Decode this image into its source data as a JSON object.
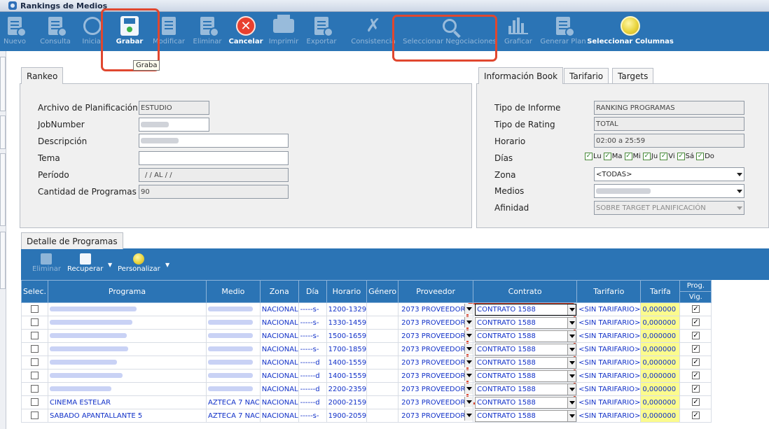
{
  "window": {
    "title": "Rankings de Medios"
  },
  "toolbar": [
    {
      "id": "nuevo",
      "label": "Nuevo",
      "icon": "new-document-icon",
      "enabled": false
    },
    {
      "id": "consulta",
      "label": "Consulta",
      "icon": "query-icon",
      "enabled": false
    },
    {
      "id": "inicial",
      "label": "Inicial",
      "icon": "play-icon",
      "enabled": false
    },
    {
      "id": "grabar",
      "label": "Grabar",
      "icon": "save-icon",
      "enabled": true
    },
    {
      "id": "modificar",
      "label": "Modificar",
      "icon": "edit-icon",
      "enabled": false
    },
    {
      "id": "eliminar",
      "label": "Eliminar",
      "icon": "delete-document-icon",
      "enabled": false
    },
    {
      "id": "cancelar",
      "label": "Cancelar",
      "icon": "cancel-icon",
      "enabled": true
    },
    {
      "id": "imprimir",
      "label": "Imprimir",
      "icon": "printer-icon",
      "enabled": false
    },
    {
      "id": "exportar",
      "label": "Exportar",
      "icon": "export-icon",
      "enabled": false
    },
    {
      "id": "consistencia",
      "label": "Consistencia",
      "icon": "tools-icon",
      "enabled": false
    },
    {
      "id": "seleccionar_negociaciones",
      "label": "Seleccionar Negociaciones",
      "icon": "magnifier-icon",
      "enabled": false
    },
    {
      "id": "graficar",
      "label": "Graficar",
      "icon": "bar-chart-icon",
      "enabled": false
    },
    {
      "id": "generar_plan",
      "label": "Generar Plan",
      "icon": "generate-plan-icon",
      "enabled": false
    },
    {
      "id": "seleccionar_columnas",
      "label": "Seleccionar Columnas",
      "icon": "columns-globe-icon",
      "enabled": true
    }
  ],
  "tooltip": "Graba",
  "rankeo": {
    "tab": "Rankeo",
    "fields": {
      "archivo_label": "Archivo de Planificación",
      "archivo_value": "ESTUDIO",
      "jobnumber_label": "JobNumber",
      "descripcion_label": "Descripción",
      "tema_label": "Tema",
      "tema_value": "",
      "periodo_label": "Período",
      "periodo_value": "/ /    AL  / /",
      "cantidad_label": "Cantidad de Programas",
      "cantidad_value": "90"
    }
  },
  "info_book": {
    "tabs": [
      "Información Book",
      "Tarifario",
      "Targets"
    ],
    "fields": {
      "tipo_informe_label": "Tipo de Informe",
      "tipo_informe_value": "RANKING PROGRAMAS",
      "tipo_rating_label": "Tipo de Rating",
      "tipo_rating_value": "TOTAL",
      "horario_label": "Horario",
      "horario_value": "02:00 a 25:59",
      "dias_label": "Días",
      "zona_label": "Zona",
      "zona_value": "<TODAS>",
      "medios_label": "Medios",
      "afinidad_label": "Afinidad",
      "afinidad_value": "SOBRE TARGET PLANIFICACIÓN"
    },
    "days": [
      {
        "label": "Lu",
        "checked": true
      },
      {
        "label": "Ma",
        "checked": true
      },
      {
        "label": "Mi",
        "checked": true
      },
      {
        "label": "Ju",
        "checked": true
      },
      {
        "label": "Vi",
        "checked": true
      },
      {
        "label": "Sá",
        "checked": true
      },
      {
        "label": "Do",
        "checked": true
      }
    ]
  },
  "detalle": {
    "tab": "Detalle de Programas",
    "toolbar": [
      {
        "label": "Eliminar",
        "enabled": false
      },
      {
        "label": "Recuperar",
        "enabled": true
      },
      {
        "label": "Personalizar",
        "enabled": true
      }
    ],
    "columns": [
      "Selec.",
      "Programa",
      "Medio",
      "Zona",
      "Día",
      "Horario",
      "Género",
      "Proveedor",
      "Contrato",
      "Tarifario",
      "Tarifa",
      "Prog.",
      "Vig."
    ],
    "rows": [
      {
        "programa": "",
        "medio": "",
        "zona": "NACIONAL",
        "dia": "-----s-",
        "horario": "1200-1329",
        "genero": "",
        "proveedor": "2073 PROVEEDOR",
        "contrato": "CONTRATO 1588",
        "tarifario": "<SIN TARIFARIO>",
        "tarifa": "0,000000",
        "vig": true
      },
      {
        "programa": "",
        "medio": "",
        "zona": "NACIONAL",
        "dia": "-----s-",
        "horario": "1330-1459",
        "genero": "",
        "proveedor": "2073 PROVEEDOR",
        "contrato": "CONTRATO 1588",
        "tarifario": "<SIN TARIFARIO>",
        "tarifa": "0,000000",
        "vig": true
      },
      {
        "programa": "",
        "medio": "",
        "zona": "NACIONAL",
        "dia": "-----s-",
        "horario": "1500-1659",
        "genero": "",
        "proveedor": "2073 PROVEEDOR",
        "contrato": "CONTRATO 1588",
        "tarifario": "<SIN TARIFARIO>",
        "tarifa": "0,000000",
        "vig": true
      },
      {
        "programa": "",
        "medio": "",
        "zona": "NACIONAL",
        "dia": "-----s-",
        "horario": "1700-1859",
        "genero": "",
        "proveedor": "2073 PROVEEDOR",
        "contrato": "CONTRATO 1588",
        "tarifario": "<SIN TARIFARIO>",
        "tarifa": "0,000000",
        "vig": true
      },
      {
        "programa": "",
        "medio": "",
        "zona": "NACIONAL",
        "dia": "------d",
        "horario": "1400-1559",
        "genero": "",
        "proveedor": "2073 PROVEEDOR",
        "contrato": "CONTRATO 1588",
        "tarifario": "<SIN TARIFARIO>",
        "tarifa": "0,000000",
        "vig": true
      },
      {
        "programa": "",
        "medio": "",
        "zona": "NACIONAL",
        "dia": "------d",
        "horario": "1400-1559",
        "genero": "",
        "proveedor": "2073 PROVEEDOR",
        "contrato": "CONTRATO 1588",
        "tarifario": "<SIN TARIFARIO>",
        "tarifa": "0,000000",
        "vig": true
      },
      {
        "programa": "",
        "medio": "",
        "zona": "NACIONAL",
        "dia": "------d",
        "horario": "2200-2359",
        "genero": "",
        "proveedor": "2073 PROVEEDOR",
        "contrato": "CONTRATO 1588",
        "tarifario": "<SIN TARIFARIO>",
        "tarifa": "0,000000",
        "vig": true
      },
      {
        "programa": "CINEMA ESTELAR",
        "medio": "AZTECA 7 NAC",
        "zona": "NACIONAL",
        "dia": "------d",
        "horario": "2000-2159",
        "genero": "",
        "proveedor": "2073 PROVEEDOR",
        "contrato": "CONTRATO 1588",
        "tarifario": "<SIN TARIFARIO>",
        "tarifa": "0,000000",
        "vig": true
      },
      {
        "programa": "SABADO APANTALLANTE 5",
        "medio": "AZTECA 7 NAC",
        "zona": "NACIONAL",
        "dia": "-----s-",
        "horario": "1900-2059",
        "genero": "",
        "proveedor": "2073 PROVEEDOR",
        "contrato": "CONTRATO 1588",
        "tarifario": "<SIN TARIFARIO>",
        "tarifa": "0,000000",
        "vig": true
      }
    ]
  },
  "colors": {
    "toolbar_bg": "#2b74b5",
    "highlight_red": "#e0472f",
    "tarifa_bg": "#fbfb8e",
    "link_blue": "#1030c8"
  }
}
